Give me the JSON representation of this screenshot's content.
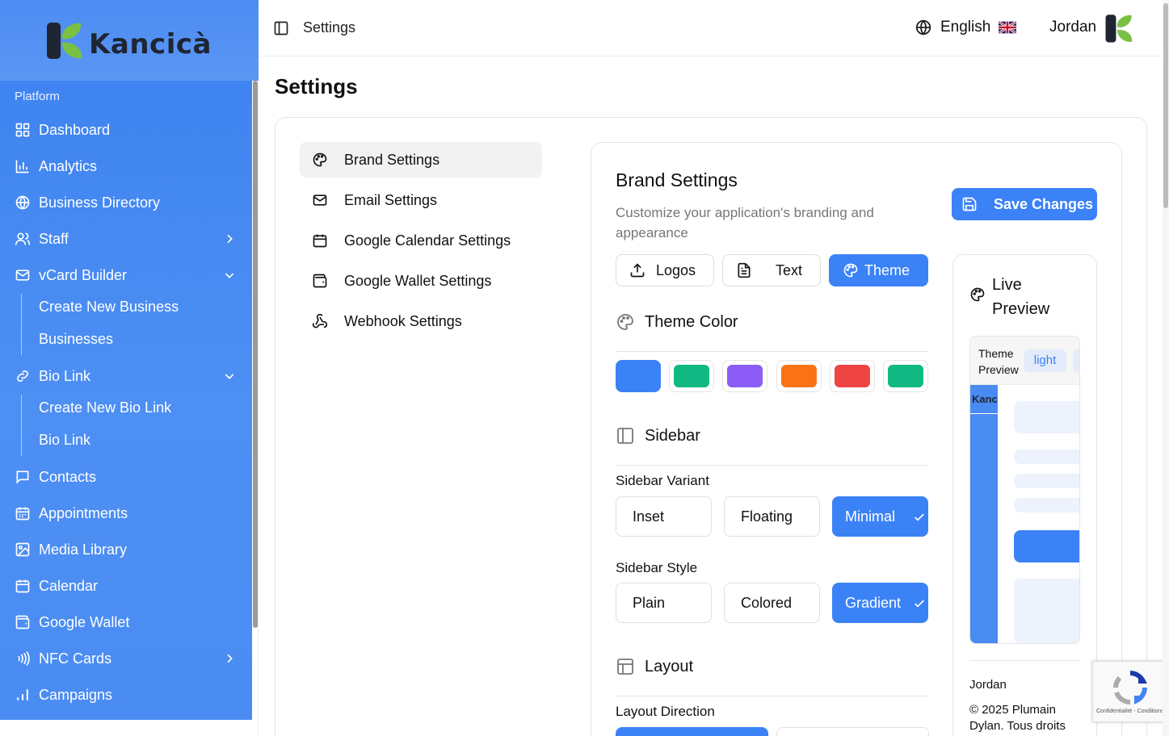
{
  "brand": {
    "logo_text": "Kancicà",
    "primary": "#3b82f6",
    "sidebar_gradient": "#4a8cf2",
    "logo_green": "#7ac143",
    "logo_dark": "#1f2533"
  },
  "sidebar": {
    "section": "Platform",
    "items": [
      {
        "label": "Dashboard",
        "icon": "grid-icon"
      },
      {
        "label": "Analytics",
        "icon": "bar-chart-icon"
      },
      {
        "label": "Business Directory",
        "icon": "globe-icon"
      },
      {
        "label": "Staff",
        "icon": "users-icon"
      },
      {
        "label": "vCard Builder",
        "icon": "mail-icon"
      },
      {
        "label": "Bio Link",
        "icon": "link-icon"
      },
      {
        "label": "Contacts",
        "icon": "message-icon"
      },
      {
        "label": "Appointments",
        "icon": "calendar-grid-icon"
      },
      {
        "label": "Media Library",
        "icon": "image-icon"
      },
      {
        "label": "Calendar",
        "icon": "calendar-icon"
      },
      {
        "label": "Google Wallet",
        "icon": "wallet-icon"
      },
      {
        "label": "NFC Cards",
        "icon": "nfc-icon"
      },
      {
        "label": "Campaigns",
        "icon": "signal-icon"
      }
    ],
    "vcard_sub": [
      "Create New Business",
      "Businesses"
    ],
    "biolink_sub": [
      "Create New Bio Link",
      "Bio Link"
    ]
  },
  "topbar": {
    "title": "Settings",
    "language": "English",
    "user": "Jordan"
  },
  "page": {
    "title": "Settings"
  },
  "settings_nav": [
    "Brand Settings",
    "Email Settings",
    "Google Calendar Settings",
    "Google Wallet Settings",
    "Webhook Settings"
  ],
  "brand_settings": {
    "title": "Brand Settings",
    "subtitle": "Customize your application's branding and appearance",
    "save_label": "Save Changes",
    "tabs": [
      "Logos",
      "Text",
      "Theme"
    ],
    "active_tab": "Theme",
    "theme_color_title": "Theme Color",
    "theme_colors": [
      "#3b82f6",
      "#10b981",
      "#8b5cf6",
      "#f97316",
      "#ef4444",
      "#10b981"
    ],
    "selected_color": "#3b82f6",
    "sidebar_title": "Sidebar",
    "sidebar_variant_label": "Sidebar Variant",
    "sidebar_variants": [
      "Inset",
      "Floating",
      "Minimal"
    ],
    "selected_variant": "Minimal",
    "sidebar_style_label": "Sidebar Style",
    "sidebar_styles": [
      "Plain",
      "Colored",
      "Gradient"
    ],
    "selected_style": "Gradient",
    "layout_title": "Layout",
    "layout_direction_label": "Layout Direction"
  },
  "preview": {
    "title": "Live Preview",
    "theme_preview": "Theme Preview",
    "mode": "light",
    "mini_logo": "Kanc",
    "footer_user": "Jordan",
    "footer_copy": "© 2025 Plumain Dylan. Tous droits"
  },
  "recaptcha": {
    "text": "Confidentialité - Conditions"
  }
}
